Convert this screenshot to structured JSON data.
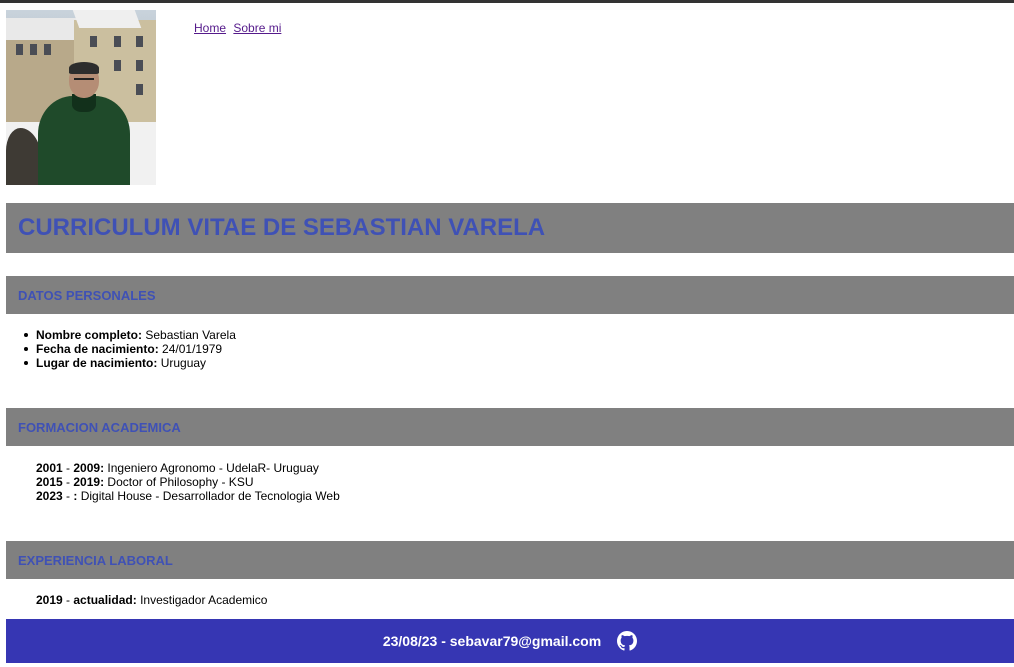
{
  "nav": {
    "home_label": "Home",
    "about_label": "Sobre mi"
  },
  "title": "CURRICULUM VITAE DE SEBASTIAN VARELA",
  "personal": {
    "heading": "DATOS PERSONALES",
    "items": [
      {
        "label": "Nombre completo:",
        "value": "Sebastian Varela"
      },
      {
        "label": "Fecha de nacimiento:",
        "value": "24/01/1979"
      },
      {
        "label": "Lugar de nacimiento:",
        "value": "Uruguay"
      }
    ]
  },
  "education": {
    "heading": "FORMACION ACADEMICA",
    "items": [
      {
        "start": "2001",
        "sep": " - ",
        "end": "2009:",
        "value": "Ingeniero Agronomo - UdelaR- Uruguay"
      },
      {
        "start": "2015",
        "sep": " - ",
        "end": "2019:",
        "value": "Doctor of Philosophy - KSU"
      },
      {
        "start": "2023",
        "sep": " - ",
        "end": ":",
        "value": "Digital House - Desarrollador de Tecnologia Web"
      }
    ]
  },
  "work": {
    "heading": "EXPERIENCIA LABORAL",
    "items": [
      {
        "start": "2019",
        "sep": " - ",
        "end": "actualidad:",
        "value": "Investigador Academico"
      }
    ]
  },
  "footer": {
    "text": "23/08/23 - sebavar79@gmail.com",
    "icon": "github-icon"
  },
  "colors": {
    "section_bar": "#808080",
    "heading_text": "#3f51b5",
    "footer_bg": "#3636b3"
  }
}
